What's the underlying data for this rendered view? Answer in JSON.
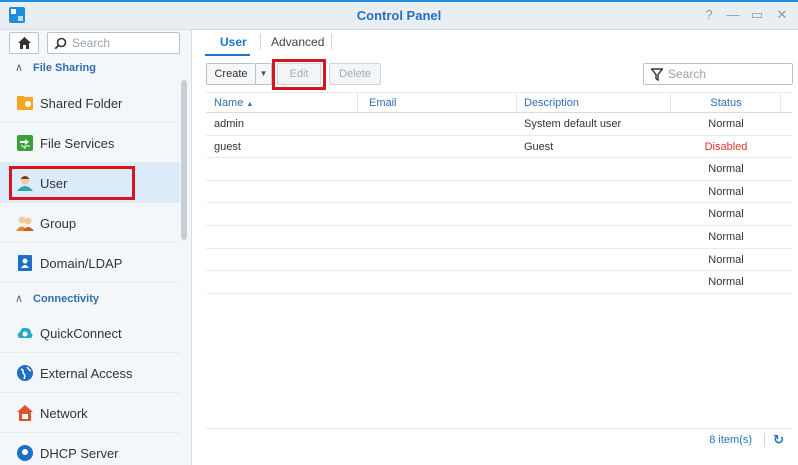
{
  "window": {
    "title": "Control Panel"
  },
  "sidebar": {
    "search_placeholder": "Search",
    "sections": [
      {
        "label": "File Sharing"
      },
      {
        "label": "Connectivity"
      }
    ],
    "items": [
      {
        "label": "Shared Folder",
        "icon": "shared-folder-icon"
      },
      {
        "label": "File Services",
        "icon": "file-services-icon"
      },
      {
        "label": "User",
        "icon": "user-icon"
      },
      {
        "label": "Group",
        "icon": "group-icon"
      },
      {
        "label": "Domain/LDAP",
        "icon": "domain-ldap-icon"
      },
      {
        "label": "QuickConnect",
        "icon": "quickconnect-icon"
      },
      {
        "label": "External Access",
        "icon": "external-access-icon"
      },
      {
        "label": "Network",
        "icon": "network-icon"
      },
      {
        "label": "DHCP Server",
        "icon": "dhcp-server-icon"
      }
    ]
  },
  "main": {
    "tabs": [
      {
        "label": "User"
      },
      {
        "label": "Advanced"
      }
    ],
    "toolbar": {
      "create_label": "Create",
      "edit_label": "Edit",
      "delete_label": "Delete",
      "search_placeholder": "Search"
    },
    "columns": {
      "name": "Name",
      "email": "Email",
      "description": "Description",
      "status": "Status"
    },
    "rows": [
      {
        "name": "admin",
        "email": "",
        "description": "System default user",
        "status": "Normal"
      },
      {
        "name": "guest",
        "email": "",
        "description": "Guest",
        "status": "Disabled"
      },
      {
        "name": "",
        "email": "",
        "description": "",
        "status": "Normal"
      },
      {
        "name": "",
        "email": "",
        "description": "",
        "status": "Normal"
      },
      {
        "name": "",
        "email": "",
        "description": "",
        "status": "Normal"
      },
      {
        "name": "",
        "email": "",
        "description": "",
        "status": "Normal"
      },
      {
        "name": "",
        "email": "",
        "description": "",
        "status": "Normal"
      },
      {
        "name": "",
        "email": "",
        "description": "",
        "status": "Normal"
      }
    ],
    "footer": {
      "count": "8 item(s)"
    }
  },
  "colors": {
    "accent": "#1f73c9",
    "disabled_status": "#e1352c",
    "highlight": "#d9141c"
  }
}
